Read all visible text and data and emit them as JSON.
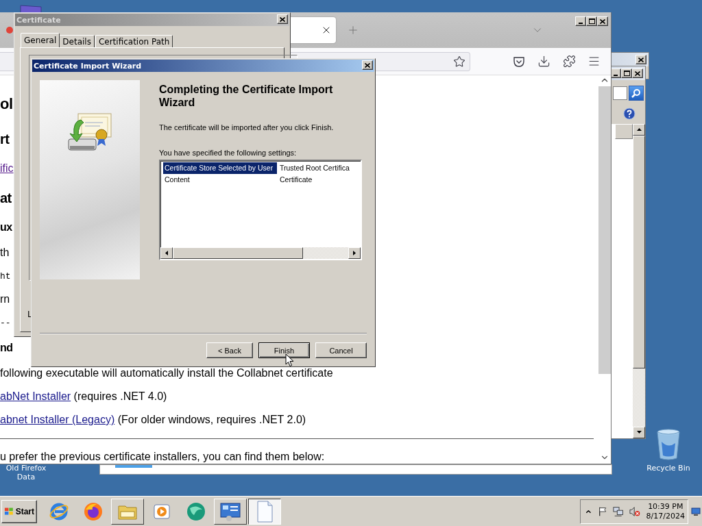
{
  "desktop": {
    "icons": [
      {
        "kind": "folder",
        "label": "Old Firefox Data"
      },
      {
        "kind": "recycle",
        "label": "Recycle Bin"
      }
    ]
  },
  "browser": {
    "page": {
      "lines": [
        {
          "kind": "h1",
          "text": "ol"
        },
        {
          "kind": "h2",
          "text": "rt"
        },
        {
          "kind": "link",
          "text": "ific"
        },
        {
          "kind": "h2",
          "text": "at"
        },
        {
          "kind": "h3",
          "text": "ux"
        },
        {
          "kind": "text",
          "text": "th"
        },
        {
          "kind": "code",
          "text": "ht"
        },
        {
          "kind": "text",
          "text": "rn"
        },
        {
          "kind": "code",
          "text": "--"
        },
        {
          "kind": "h3",
          "text": "nd"
        },
        {
          "kind": "text",
          "text": "following executable will automatically install the Collabnet certificate"
        },
        {
          "kind": "item",
          "link": "abNet Installer",
          "text": " (requires .NET 4.0)"
        },
        {
          "kind": "item",
          "link": "abnet Installer (Legacy)",
          "text": " (For older windows, requires .NET 2.0)"
        },
        {
          "kind": "rule"
        },
        {
          "kind": "text",
          "text": "u prefer the previous certificate installers, you can find them below:"
        }
      ]
    }
  },
  "certificate_dialog": {
    "title": "Certificate",
    "tabs": [
      {
        "label": "General",
        "selected": true
      },
      {
        "label": "Details",
        "selected": false
      },
      {
        "label": "Certification Path",
        "selected": false
      }
    ],
    "text": "L"
  },
  "wizard": {
    "title": "Certificate Import Wizard",
    "heading": "Completing the Certificate Import Wizard",
    "message": "The certificate will be imported after you click Finish.",
    "settings_label": "You have specified the following settings:",
    "settings": [
      {
        "field": "Certificate Store Selected by User",
        "value": "Trusted Root Certifica",
        "selected": true
      },
      {
        "field": "Content",
        "value": "Certificate",
        "selected": false
      }
    ],
    "buttons": [
      {
        "label": "< Back",
        "default": false
      },
      {
        "label": "Finish",
        "default": true
      },
      {
        "label": "Cancel",
        "default": false
      }
    ]
  },
  "taskbar": {
    "start": "Start",
    "apps": [
      {
        "kind": "ie",
        "running": false,
        "active": false
      },
      {
        "kind": "firefox",
        "running": false,
        "active": false
      },
      {
        "kind": "folder",
        "running": true,
        "active": false
      },
      {
        "kind": "media",
        "running": false,
        "active": false
      },
      {
        "kind": "globe",
        "running": false,
        "active": false
      },
      {
        "kind": "control",
        "running": true,
        "active": false
      },
      {
        "kind": "document",
        "running": true,
        "active": true
      }
    ],
    "clock": {
      "time": "10:39 PM",
      "date": "8/17/2024"
    }
  }
}
